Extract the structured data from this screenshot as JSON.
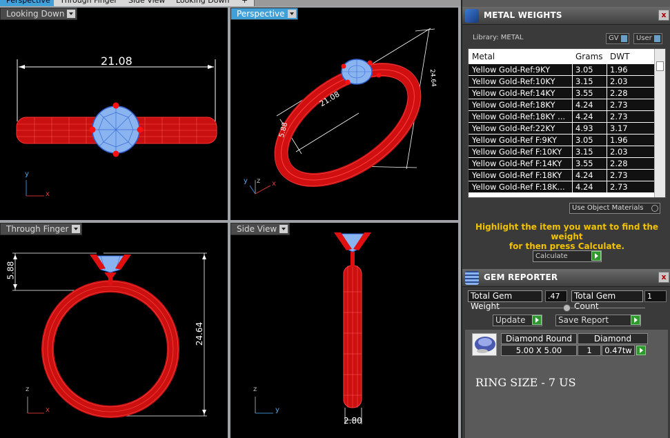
{
  "tabs": [
    {
      "label": "Perspective",
      "active": true
    },
    {
      "label": "Through Finger",
      "active": false
    },
    {
      "label": "Side View",
      "active": false
    },
    {
      "label": "Looking Down",
      "active": false
    },
    {
      "label": "+",
      "active": false
    }
  ],
  "viewports": {
    "looking_down": {
      "label": "Looking Down",
      "dimension": "21.08",
      "axes": {
        "vertical": "y",
        "horizontal": "x"
      }
    },
    "perspective": {
      "label": "Perspective",
      "dim_length": "21.08",
      "dim_height": "5.88",
      "dim_diameter": "24.64",
      "axes": {
        "a": "y",
        "b": "z",
        "c": "x"
      }
    },
    "through_finger": {
      "label": "Through Finger",
      "dim_height": "5.88",
      "dim_diameter": "24.64",
      "axes": {
        "vertical": "z",
        "horizontal": "x"
      }
    },
    "side_view": {
      "label": "Side View",
      "dim_width": "2.80",
      "axes": {
        "vertical": "z",
        "horizontal": "y"
      }
    }
  },
  "metal_weights": {
    "title": "METAL WEIGHTS",
    "library_label": "Library: METAL",
    "gv_toggle": "GV",
    "user_toggle": "User",
    "columns": [
      "Metal",
      "Grams",
      "DWT"
    ],
    "rows": [
      [
        "Yellow Gold-Ref:9KY",
        "3.05",
        "1.96"
      ],
      [
        "Yellow Gold-Ref:10KY",
        "3.15",
        "2.03"
      ],
      [
        "Yellow Gold-Ref:14KY",
        "3.55",
        "2.28"
      ],
      [
        "Yellow Gold-Ref:18KY",
        "4.24",
        "2.73"
      ],
      [
        "Yellow Gold-Ref:18KY ...",
        "4.24",
        "2.73"
      ],
      [
        "Yellow Gold-Ref:22KY",
        "4.93",
        "3.17"
      ],
      [
        "Yellow Gold-Ref F:9KY",
        "3.05",
        "1.96"
      ],
      [
        "Yellow Gold-Ref F:10KY",
        "3.15",
        "2.03"
      ],
      [
        "Yellow Gold-Ref F:14KY",
        "3.55",
        "2.28"
      ],
      [
        "Yellow Gold-Ref F:18KY",
        "4.24",
        "2.73"
      ],
      [
        "Yellow Gold-Ref F:18K...",
        "4.24",
        "2.73"
      ]
    ],
    "use_object_materials": "Use Object Materials",
    "hint_line1": "Highlight the item you want to find the weight",
    "hint_line2": "for then press Calculate.",
    "calculate": "Calculate"
  },
  "gem_reporter": {
    "title": "GEM REPORTER",
    "total_weight_label": "Total Gem Weight",
    "total_weight_value": ".47",
    "total_count_label": "Total Gem Count",
    "total_count_value": "1",
    "update": "Update",
    "save_report": "Save Report",
    "gem": {
      "shape": "Diamond Round",
      "material": "Diamond",
      "size": "5.00 X 5.00",
      "count": "1",
      "weight": "0.47tw"
    },
    "ring_size": "RING SIZE - 7 US"
  },
  "colors": {
    "accent": "#41a0d8",
    "metal_red": "#e01818",
    "gem_blue": "#8ab4f0",
    "hint_yellow": "#f2c200"
  }
}
